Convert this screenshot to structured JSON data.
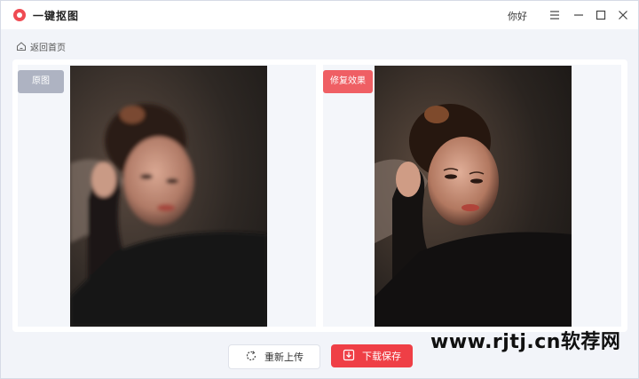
{
  "app": {
    "title": "一键抠图",
    "user_name": "你好"
  },
  "nav": {
    "back_label": "返回首页"
  },
  "panes": {
    "original_label": "原图",
    "result_label": "修复效果"
  },
  "actions": {
    "reupload_label": "重新上传",
    "download_label": "下载保存"
  },
  "watermark": {
    "text": "www.rjtj.cn软荐网"
  },
  "colors": {
    "accent": "#ef3f46",
    "original_tag": "#aeb3c2",
    "result_tag": "#ef5f64",
    "background": "#f2f4f9"
  },
  "icons": {
    "logo": "app-logo-icon",
    "menu": "menu-icon",
    "minimize": "minimize-icon",
    "maximize": "maximize-icon",
    "close": "close-icon",
    "back": "home-icon",
    "reupload": "refresh-icon",
    "download": "download-icon"
  }
}
